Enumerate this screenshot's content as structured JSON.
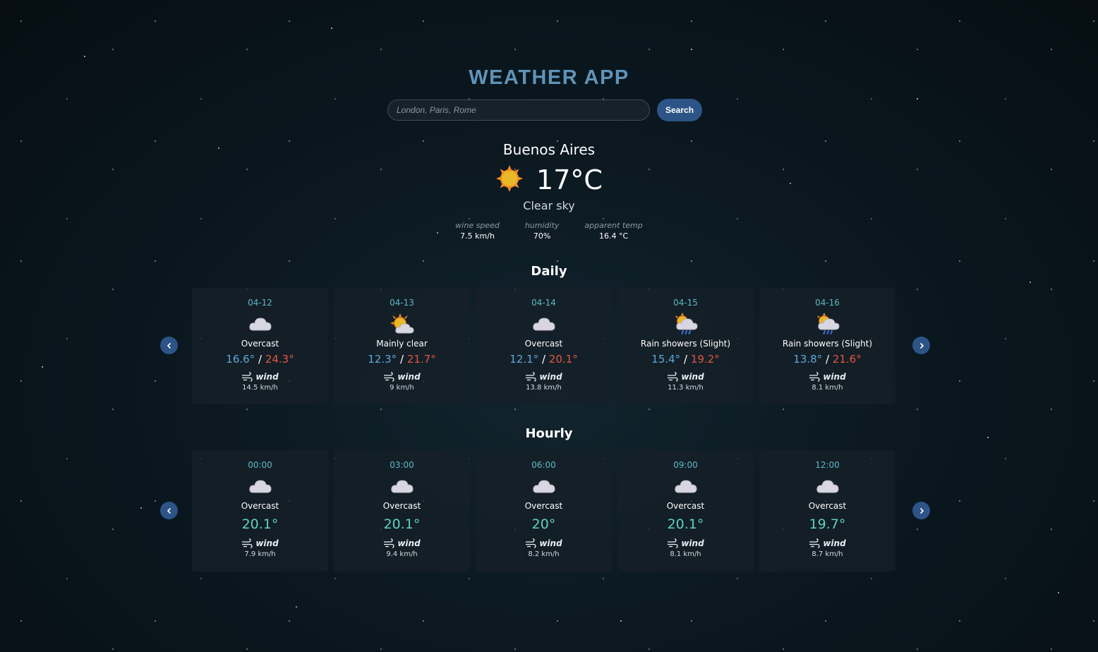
{
  "app": {
    "title": "WEATHER APP"
  },
  "search": {
    "placeholder": "London, Paris, Rome",
    "button_label": "Search"
  },
  "current": {
    "city": "Buenos Aires",
    "icon": "sun-icon",
    "temperature": "17°C",
    "condition": "Clear sky",
    "stats": [
      {
        "label": "wine speed",
        "value": "7.5 km/h"
      },
      {
        "label": "humidity",
        "value": "70%"
      },
      {
        "label": "apparent temp",
        "value": "16.4 °C"
      }
    ]
  },
  "daily": {
    "title": "Daily",
    "items": [
      {
        "date": "04-12",
        "icon": "cloud-icon",
        "desc": "Overcast",
        "min": "16.6°",
        "sep": "/",
        "max": "24.3°",
        "wind_label": "wind",
        "wind": "14.5 km/h"
      },
      {
        "date": "04-13",
        "icon": "sun-cloud-icon",
        "desc": "Mainly clear",
        "min": "12.3°",
        "sep": "/",
        "max": "21.7°",
        "wind_label": "wind",
        "wind": "9 km/h"
      },
      {
        "date": "04-14",
        "icon": "cloud-icon",
        "desc": "Overcast",
        "min": "12.1°",
        "sep": "/",
        "max": "20.1°",
        "wind_label": "wind",
        "wind": "13.8 km/h"
      },
      {
        "date": "04-15",
        "icon": "sun-rain-icon",
        "desc": "Rain showers (Slight)",
        "min": "15.4°",
        "sep": "/",
        "max": "19.2°",
        "wind_label": "wind",
        "wind": "11.3 km/h"
      },
      {
        "date": "04-16",
        "icon": "sun-rain-icon",
        "desc": "Rain showers (Slight)",
        "min": "13.8°",
        "sep": "/",
        "max": "21.6°",
        "wind_label": "wind",
        "wind": "8.1 km/h"
      }
    ]
  },
  "hourly": {
    "title": "Hourly",
    "items": [
      {
        "time": "00:00",
        "icon": "cloud-icon",
        "desc": "Overcast",
        "temp": "20.1°",
        "wind_label": "wind",
        "wind": "7.9 km/h"
      },
      {
        "time": "03:00",
        "icon": "cloud-icon",
        "desc": "Overcast",
        "temp": "20.1°",
        "wind_label": "wind",
        "wind": "9.4 km/h"
      },
      {
        "time": "06:00",
        "icon": "cloud-icon",
        "desc": "Overcast",
        "temp": "20°",
        "wind_label": "wind",
        "wind": "8.2 km/h"
      },
      {
        "time": "09:00",
        "icon": "cloud-icon",
        "desc": "Overcast",
        "temp": "20.1°",
        "wind_label": "wind",
        "wind": "8.1 km/h"
      },
      {
        "time": "12:00",
        "icon": "cloud-icon",
        "desc": "Overcast",
        "temp": "19.7°",
        "wind_label": "wind",
        "wind": "8.7 km/h"
      }
    ]
  },
  "navigation": {
    "prev_icon": "chevron-left-icon",
    "next_icon": "chevron-right-icon"
  },
  "colors": {
    "accent": "#2c5487",
    "title": "#5f93b8",
    "min_temp": "#5ea8d8",
    "max_temp": "#e2563e",
    "hourly_temp": "#5fd0c0",
    "label": "#5fb8c4"
  }
}
